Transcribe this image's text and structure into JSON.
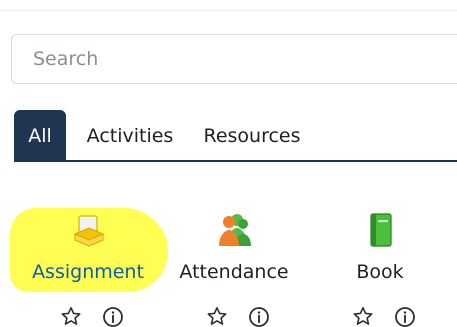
{
  "search": {
    "placeholder": "Search",
    "value": ""
  },
  "tabs": [
    {
      "label": "All",
      "active": true
    },
    {
      "label": "Activities",
      "active": false
    },
    {
      "label": "Resources",
      "active": false
    }
  ],
  "modules": [
    {
      "label": "Assignment",
      "icon": "assignment-icon",
      "highlighted": true
    },
    {
      "label": "Attendance",
      "icon": "attendance-icon",
      "highlighted": false
    },
    {
      "label": "Book",
      "icon": "book-icon",
      "highlighted": false
    }
  ],
  "colors": {
    "active_tab_bg": "#1f3552",
    "highlight": "#ffff4a",
    "link": "#0b5ea8"
  }
}
